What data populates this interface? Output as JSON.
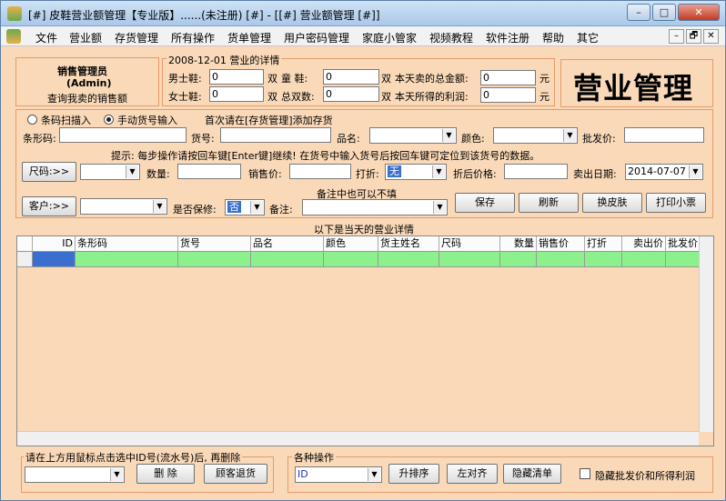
{
  "window": {
    "title": "[#] 皮鞋营业额管理【专业版】......(未注册) [#] - [[#] 营业额管理 [#]]",
    "min": "–",
    "max": "□",
    "close": "✕"
  },
  "menu": [
    "文件",
    "营业额",
    "存货管理",
    "所有操作",
    "货单管理",
    "用户密码管理",
    "家庭小管家",
    "视频教程",
    "软件注册",
    "帮助",
    "其它"
  ],
  "mdi": {
    "min": "–",
    "restore": "🗗",
    "close": "✕"
  },
  "user": {
    "role": "销售管理员",
    "name": "(Admin)",
    "link": "查询我卖的销售额"
  },
  "summary": {
    "legend": "2008-12-01 营业的详情",
    "men_label": "男士鞋:",
    "men_value": "0",
    "women_label": "女士鞋:",
    "women_value": "0",
    "child_label": "童  鞋:",
    "child_value": "0",
    "total_pairs_label": "总双数:",
    "total_pairs_value": "0",
    "unit_pair": "双",
    "total_sales_label": "本天卖的总金额:",
    "total_sales_value": "0",
    "profit_label": "本天所得的利润:",
    "profit_value": "0",
    "unit_yuan": "元"
  },
  "banner": "营业管理",
  "entry": {
    "scan_label": "条码扫描入",
    "manual_label": "手动货号输入",
    "hint_top": "首次请在[存货管理]添加存货",
    "barcode_label": "条形码:",
    "item_no_label": "货号:",
    "product_label": "品名:",
    "color_label": "颜色:",
    "wholesale_label": "批发价:",
    "hint": "提示: 每步操作请按回车键[Enter键]继续! 在货号中输入货号后按回车键可定位到该货号的数据。",
    "size_btn": "尺码:>>",
    "qty_label": "数量:",
    "price_label": "销售价:",
    "discount_label": "打折:",
    "discount_value": "无",
    "after_discount_label": "折后价格:",
    "date_label": "卖出日期:",
    "date_value": "2014-07-07",
    "customer_btn": "客户:>>",
    "warranty_label": "是否保修:",
    "warranty_value": "否",
    "note_label": "备注:",
    "note_hint": "备注中也可以不填",
    "save": "保存",
    "refresh": "刷新",
    "skin": "换皮肤",
    "print": "打印小票"
  },
  "grid": {
    "caption": "以下是当天的营业详情",
    "columns": [
      "ID",
      "条形码",
      "货号",
      "品名",
      "颜色",
      "货主姓名",
      "尺码",
      "数量",
      "销售价",
      "打折",
      "卖出价",
      "批发价"
    ]
  },
  "delete_panel": {
    "legend": "请在上方用鼠标点击选中ID号(流水号)后, 再删除",
    "delete": "删 除",
    "return": "顾客退货"
  },
  "ops_panel": {
    "legend": "各种操作",
    "field_value": "ID",
    "sort": "升排序",
    "align": "左对齐",
    "hide": "隐藏清单",
    "hide_check": "隐藏批发价和所得利润"
  },
  "colors": {
    "accent_red": "#e00000",
    "link_blue": "#1d32c8",
    "hint_orange": "#e8872a",
    "row_green": "#8cf08c",
    "panel_bg": "#f9d9b8"
  }
}
